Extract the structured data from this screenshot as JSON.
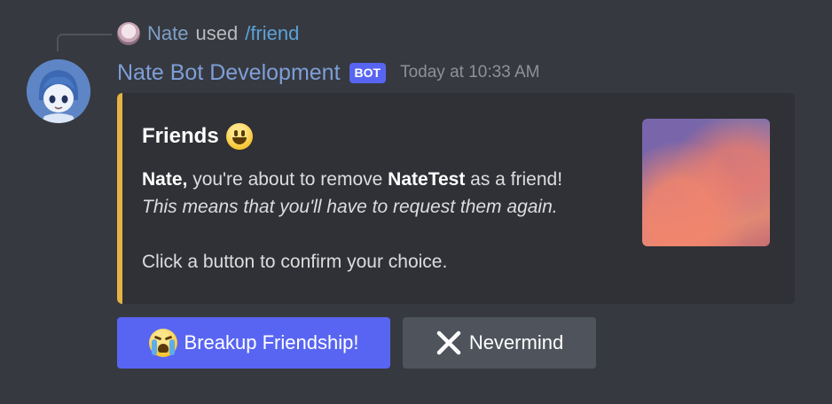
{
  "reply": {
    "user": "Nate",
    "verb": "used",
    "command": "/friend"
  },
  "message": {
    "author": "Nate Bot Development",
    "bot_tag": "BOT",
    "timestamp": "Today at 10:33 AM"
  },
  "embed": {
    "accent_color": "#e6b444",
    "title": "Friends",
    "title_emoji": "grinning-face-emoji",
    "desc_name": "Nate,",
    "desc_text1": " you're about to remove ",
    "desc_target": "NateTest",
    "desc_text2": " as a friend!",
    "desc_italic": "This means that you'll have to request them again.",
    "desc_footer": "Click a button to confirm your choice."
  },
  "buttons": {
    "confirm": {
      "label": "Breakup Friendship!",
      "emoji": "crying-face-emoji",
      "color": "#5865f2"
    },
    "cancel": {
      "label": "Nevermind",
      "emoji": "cross-mark-icon",
      "color": "#4f545c"
    }
  },
  "colors": {
    "background": "#36393f",
    "embed_bg": "#2f3136",
    "username": "#7e9fd8",
    "command": "#5ba3d8"
  }
}
